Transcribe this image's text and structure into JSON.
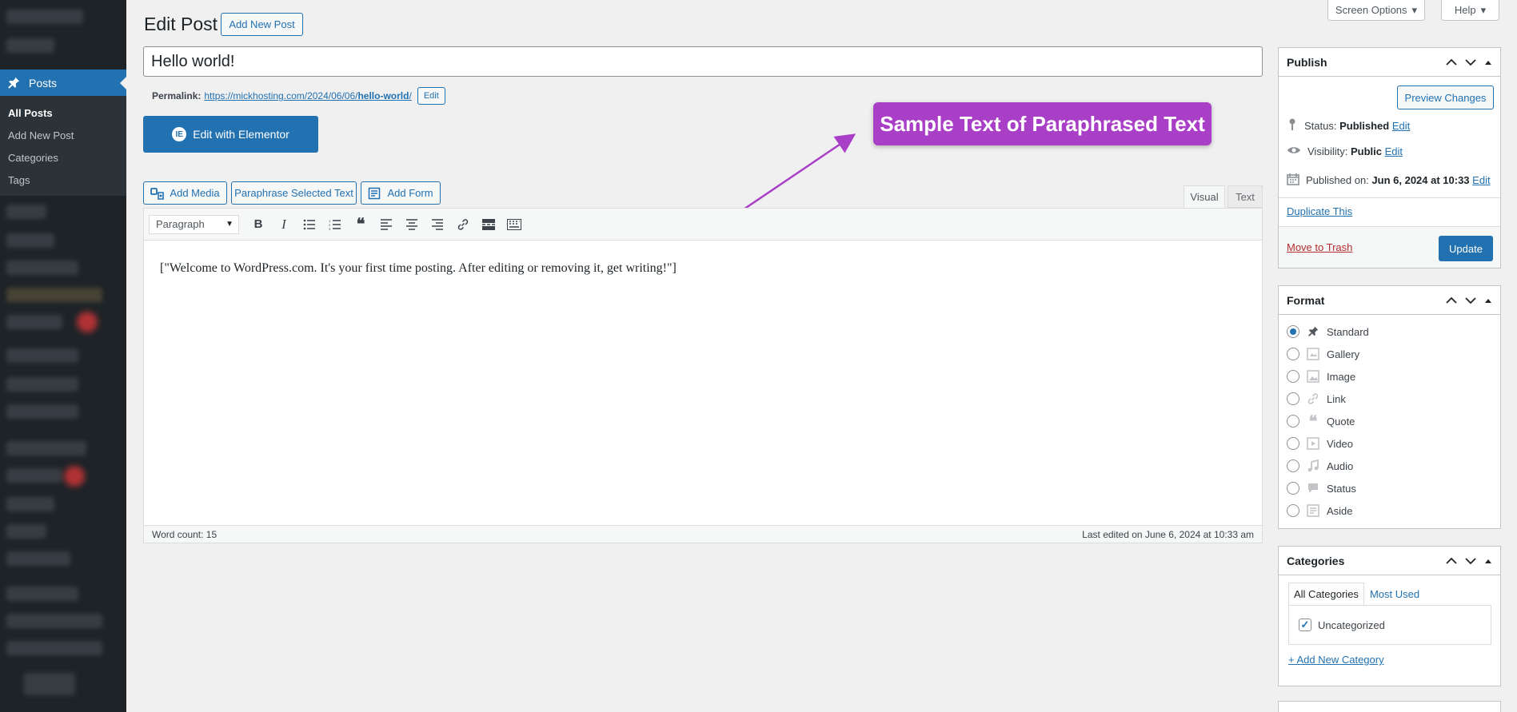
{
  "header": {
    "title": "Edit Post",
    "add_new_label": "Add New Post",
    "screen_options_label": "Screen Options",
    "help_label": "Help"
  },
  "sidebar": {
    "posts_label": "Posts",
    "items": [
      {
        "label": "All Posts",
        "current": true
      },
      {
        "label": "Add New Post"
      },
      {
        "label": "Categories"
      },
      {
        "label": "Tags"
      }
    ]
  },
  "post": {
    "title": "Hello world!",
    "permalink_label": "Permalink:",
    "permalink_base": "https://mickhosting.com/2024/06/06/",
    "permalink_slug": "hello-world",
    "permalink_trail": "/",
    "permalink_edit": "Edit"
  },
  "elementor_label": "Edit with Elementor",
  "annotation": "Sample Text of Paraphrased Text",
  "media_buttons": {
    "add_media": "Add Media",
    "paraphrase": "Paraphrase Selected Text",
    "add_form": "Add Form"
  },
  "editor": {
    "tab_visual": "Visual",
    "tab_text": "Text",
    "format": "Paragraph",
    "content": "[\"Welcome to WordPress.com. It's your first time posting. After editing or removing it, get writing!\"]",
    "word_count": "Word count: 15",
    "last_edited": "Last edited on June 6, 2024 at 10:33 am"
  },
  "publish": {
    "title": "Publish",
    "preview": "Preview Changes",
    "status_label": "Status:",
    "status_value": "Published",
    "visibility_label": "Visibility:",
    "visibility_value": "Public",
    "published_label": "Published on:",
    "published_value": "Jun 6, 2024 at 10:33",
    "edit": "Edit",
    "duplicate": "Duplicate This",
    "trash": "Move to Trash",
    "update": "Update"
  },
  "format_box": {
    "title": "Format",
    "options": [
      "Standard",
      "Gallery",
      "Image",
      "Link",
      "Quote",
      "Video",
      "Audio",
      "Status",
      "Aside"
    ],
    "selected": "Standard"
  },
  "categories_box": {
    "title": "Categories",
    "tab_all": "All Categories",
    "tab_used": "Most Used",
    "item": "Uncategorized",
    "add_new": "+ Add New Category"
  },
  "colors": {
    "accent": "#2271b1",
    "annotation": "#a93fc7",
    "sidebar": "#1d2327"
  }
}
